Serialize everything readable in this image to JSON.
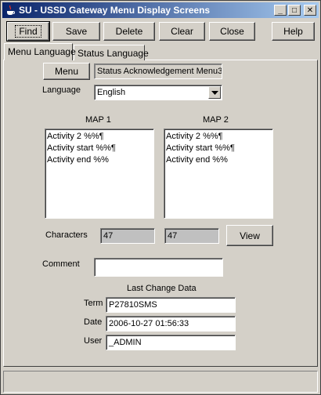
{
  "window": {
    "title": "SU - USSD Gateway Menu Display Screens",
    "controls": {
      "minimize": "_",
      "maximize": "□",
      "close": "✕"
    }
  },
  "toolbar": {
    "find": "Find",
    "save": "Save",
    "delete": "Delete",
    "clear": "Clear",
    "close": "Close",
    "help": "Help"
  },
  "tabs": [
    {
      "label": "Menu Language",
      "active": true
    },
    {
      "label": "Status Language",
      "active": false
    }
  ],
  "form": {
    "menu_button": "Menu",
    "menu_value": "Status Acknowledgement Menu3",
    "language_label": "Language",
    "language_value": "English",
    "map1_label": "MAP 1",
    "map2_label": "MAP 2",
    "map1_lines": [
      "Activity 2 %%¶",
      "Activity start %%¶",
      "Activity end %%"
    ],
    "map2_lines": [
      "Activity 2 %%¶",
      "Activity start %%¶",
      "Activity end %%"
    ],
    "characters_label": "Characters",
    "map1_chars": "47",
    "map2_chars": "47",
    "view_button": "View",
    "comment_label": "Comment",
    "comment_value": "",
    "last_change_label": "Last Change Data",
    "term_label": "Term",
    "term_value": "P27810SMS",
    "date_label": "Date",
    "date_value": "2006-10-27 01:56:33",
    "user_label": "User",
    "user_value": "_ADMIN"
  },
  "status": {
    "text": ""
  }
}
